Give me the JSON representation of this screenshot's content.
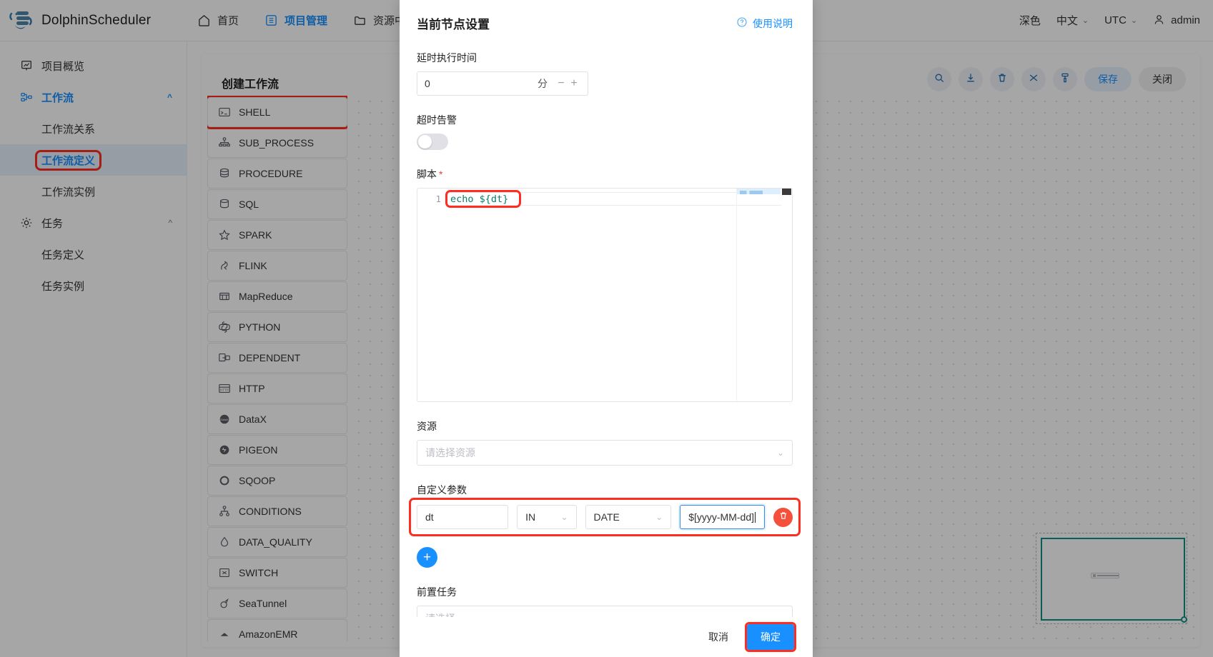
{
  "header": {
    "brand": "DolphinScheduler",
    "nav": [
      {
        "label": "首页",
        "icon": "home-icon",
        "active": false
      },
      {
        "label": "项目管理",
        "icon": "project-icon",
        "active": true
      },
      {
        "label": "资源中心",
        "icon": "folder-icon",
        "active": false
      }
    ],
    "theme_label": "深色",
    "language": "中文",
    "timezone": "UTC",
    "user": "admin",
    "user_icon": "user-icon"
  },
  "sidebar": {
    "items": [
      {
        "label": "项目概览",
        "icon": "overview-icon",
        "level": "top",
        "state": "normal"
      },
      {
        "label": "工作流",
        "icon": "workflow-icon",
        "level": "top",
        "state": "accent",
        "chevron": "chevron-up"
      },
      {
        "label": "工作流关系",
        "level": "sub",
        "state": "normal"
      },
      {
        "label": "工作流定义",
        "level": "sub",
        "state": "selected-highlight"
      },
      {
        "label": "工作流实例",
        "level": "sub",
        "state": "normal"
      },
      {
        "label": "任务",
        "icon": "gear-icon",
        "level": "top",
        "state": "normal",
        "chevron": "chevron-up"
      },
      {
        "label": "任务定义",
        "level": "sub",
        "state": "normal"
      },
      {
        "label": "任务实例",
        "level": "sub",
        "state": "normal"
      }
    ]
  },
  "workflow": {
    "title": "创建工作流",
    "toolbar": [
      {
        "name": "search-icon",
        "type": "icon",
        "label": ""
      },
      {
        "name": "download-icon",
        "type": "icon",
        "label": ""
      },
      {
        "name": "trash-icon",
        "type": "icon",
        "label": ""
      },
      {
        "name": "shuffle-icon",
        "type": "icon",
        "label": ""
      },
      {
        "name": "format-icon",
        "type": "icon",
        "label": ""
      },
      {
        "name": "save-button",
        "type": "pill-accent",
        "label": "保存"
      },
      {
        "name": "close-button",
        "type": "pill-plain",
        "label": "关闭"
      }
    ],
    "task_types": [
      {
        "label": "SHELL",
        "icon": "terminal-icon",
        "highlighted": true
      },
      {
        "label": "SUB_PROCESS",
        "icon": "sitemap-icon",
        "highlighted": false
      },
      {
        "label": "PROCEDURE",
        "icon": "database-gear-icon",
        "highlighted": false
      },
      {
        "label": "SQL",
        "icon": "database-sql-icon",
        "highlighted": false
      },
      {
        "label": "SPARK",
        "icon": "star-icon",
        "highlighted": false
      },
      {
        "label": "FLINK",
        "icon": "squirrel-icon",
        "highlighted": false
      },
      {
        "label": "MapReduce",
        "icon": "mapreduce-icon",
        "highlighted": false
      },
      {
        "label": "PYTHON",
        "icon": "python-icon",
        "highlighted": false
      },
      {
        "label": "DEPENDENT",
        "icon": "dependent-icon",
        "highlighted": false
      },
      {
        "label": "HTTP",
        "icon": "http-icon",
        "highlighted": false
      },
      {
        "label": "DataX",
        "icon": "datax-icon",
        "highlighted": false
      },
      {
        "label": "PIGEON",
        "icon": "pigeon-icon",
        "highlighted": false
      },
      {
        "label": "SQOOP",
        "icon": "sqoop-icon",
        "highlighted": false
      },
      {
        "label": "CONDITIONS",
        "icon": "conditions-icon",
        "highlighted": false
      },
      {
        "label": "DATA_QUALITY",
        "icon": "droplet-icon",
        "highlighted": false
      },
      {
        "label": "SWITCH",
        "icon": "switch-icon",
        "highlighted": false
      },
      {
        "label": "SeaTunnel",
        "icon": "seatunnel-icon",
        "highlighted": false
      },
      {
        "label": "AmazonEMR",
        "icon": "emr-icon",
        "highlighted": false
      }
    ]
  },
  "modal": {
    "title": "当前节点设置",
    "help_label": "使用说明",
    "help_icon": "question-circle-icon",
    "delay": {
      "label": "延时执行时间",
      "value": "0",
      "unit": "分",
      "minus": "−",
      "plus": "+"
    },
    "timeout_alarm": {
      "label": "超时告警",
      "enabled": false
    },
    "script": {
      "label": "脚本",
      "required_mark": "*",
      "line_number": "1",
      "code": "echo ${dt}"
    },
    "resource": {
      "label": "资源",
      "placeholder": "请选择资源",
      "value": "",
      "caret_icon": "chevron-down-icon"
    },
    "custom_params": {
      "label": "自定义参数",
      "rows": [
        {
          "name": "dt",
          "direction": "IN",
          "type": "DATE",
          "value": "$[yyyy-MM-dd]",
          "delete_icon": "trash-icon"
        }
      ],
      "add_icon": "plus-icon"
    },
    "pre_task": {
      "label": "前置任务",
      "placeholder": "请选择",
      "caret_icon": "chevron-down-icon"
    },
    "footer": {
      "cancel": "取消",
      "confirm": "确定"
    }
  },
  "colors": {
    "accent": "#1890ff",
    "highlight_outline": "#ff2d20",
    "danger": "#f5503c",
    "code_green": "#0a7c6e",
    "minimap_border": "#0d8f86"
  }
}
